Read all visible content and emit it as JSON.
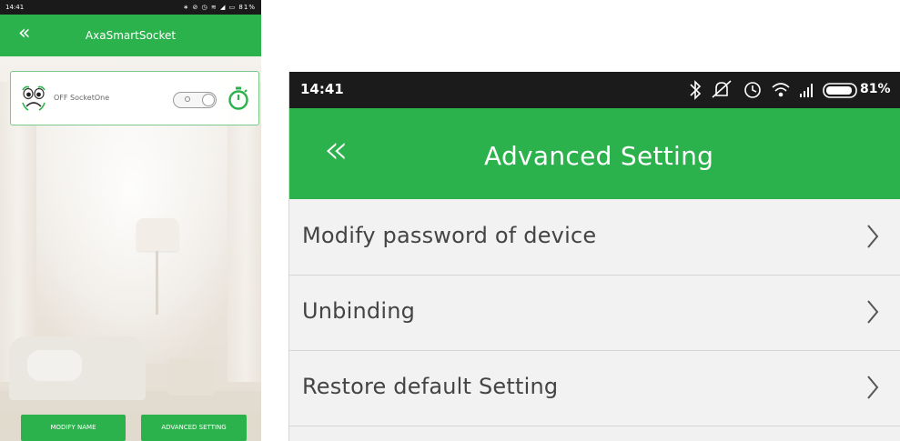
{
  "left_screen": {
    "status_bar": {
      "time": "14:41",
      "icons_text": "∗ ⊘ ◷ ≋ ◢ ▭ 81%"
    },
    "app_bar": {
      "back_glyph": "«",
      "title": "AxaSmartSocket"
    },
    "device": {
      "state": "OFF",
      "name": "SocketOne",
      "mood_icon": "sad-face-icon",
      "switch_on": false,
      "timer_icon": "stopwatch-icon"
    },
    "buttons": {
      "modify_name": "MODIFY NAME",
      "advanced_setting": "ADVANCED SETTING"
    }
  },
  "right_screen": {
    "status_bar": {
      "time": "14:41",
      "battery": "81%"
    },
    "app_bar": {
      "back_glyph": "«",
      "title": "Advanced Setting"
    },
    "menu": [
      {
        "label": "Modify password of device"
      },
      {
        "label": "Unbinding"
      },
      {
        "label": "Restore default Setting"
      }
    ]
  },
  "colors": {
    "accent": "#2bb24c",
    "status_bar": "#1b1b1b",
    "list_bg": "#f2f2f2"
  }
}
